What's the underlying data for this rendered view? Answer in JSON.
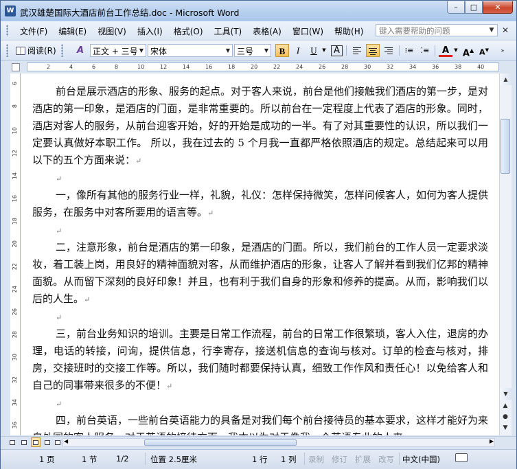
{
  "window": {
    "title": "武汉雄楚国际大酒店前台工作总结.doc - Microsoft Word",
    "app_icon_letter": "W",
    "minimize": "–",
    "maximize": "□",
    "close": "✕"
  },
  "menu": {
    "items": [
      "文件(F)",
      "编辑(E)",
      "视图(V)",
      "插入(I)",
      "格式(O)",
      "工具(T)",
      "表格(A)",
      "窗口(W)",
      "帮助(H)"
    ],
    "help_placeholder": "键入需要帮助的问题",
    "help_dropdown": "▼",
    "close_doc": "✕"
  },
  "toolbar": {
    "read_label": "阅读(R)",
    "styles_icon_label": "A",
    "style_value": "正文 + 三号",
    "font_value": "宋体",
    "size_value": "三号",
    "bold": "B",
    "italic": "I",
    "underline": "U",
    "char_border": "A",
    "font_color": "A",
    "grow_font": "A",
    "shrink_font": "A",
    "dropdown_arrow": "▼"
  },
  "ruler": {
    "marks": [
      "2",
      "4",
      "6",
      "8",
      "10",
      "12",
      "14",
      "16",
      "18",
      "20",
      "22",
      "24",
      "26",
      "28",
      "30",
      "32",
      "34",
      "36",
      "38",
      "40"
    ]
  },
  "vruler": {
    "marks": [
      "6",
      "8",
      "10",
      "12",
      "14",
      "16",
      "18",
      "20",
      "22",
      "24",
      "26",
      "28",
      "30",
      "32",
      "34",
      "36"
    ]
  },
  "document": {
    "paragraphs": [
      "前台是展示酒店的形象、服务的起点。对于客人来说，前台是他们接触我们酒店的第一步，是对酒店的第一印象，是酒店的门面，是非常重要的。所以前台在一定程度上代表了酒店的形象。同时，酒店对客人的服务，从前台迎客开始，好的开始是成功的一半。有了对其重要性的认识，所以我们一定要认真做好本职工作。  所以，我在过去的 5 个月我一直都严格依照酒店的规定。总结起来可以用以下的五个方面来说：",
      "",
      "一，像所有其他的服务行业一样，礼貌，礼仪：怎样保持微笑，怎样问候客人，如何为客人提供服务，在服务中对客所要用的语言等。",
      "",
      "二，注意形象，前台是酒店的第一印象，是酒店的门面。所以，我们前台的工作人员一定要求淡妆，着工装上岗，用良好的精神面貌对客，从而维护酒店的形象，让客人了解并看到我们亿邦的精神面貌。从而留下深刻的良好印象！并且，也有利于我们自身的形象和修养的提高。从而，影响我们以后的人生。",
      "",
      "三，前台业务知识的培训。主要是日常工作流程，前台的日常工作很繁琐，客人入住，退房的办理，电话的转接，问询，提供信息，行李寄存，接送机信息的查询与核对。订单的检查与核对，排房，交接班时的交接工作等。所以，我们随时都要保持认真，细致工作作风和责任心！以免给客人和自己的同事带来很多的不便！",
      "",
      "四，前台英语，一些前台英语能力的具备是对我们每个前台接待员的基本要求，这样才能好为来自外国的客人服务。对于英语的接待方面，我本以为对于像我一个英语专业的人来"
    ],
    "paragraph_mark": "↵"
  },
  "scrollbar": {
    "up": "▲",
    "down": "▼",
    "prev_page": "▲",
    "browse_object": "●",
    "next_page": "▼",
    "left": "◀",
    "right": "▶"
  },
  "status": {
    "page": "1 页",
    "section": "1 节",
    "page_of": "1/2",
    "position": "位置 2.5厘米",
    "line": "1 行",
    "column": "1 列",
    "rec": "录制",
    "trk": "修订",
    "ext": "扩展",
    "ovr": "改写",
    "language": "中文(中国)"
  }
}
